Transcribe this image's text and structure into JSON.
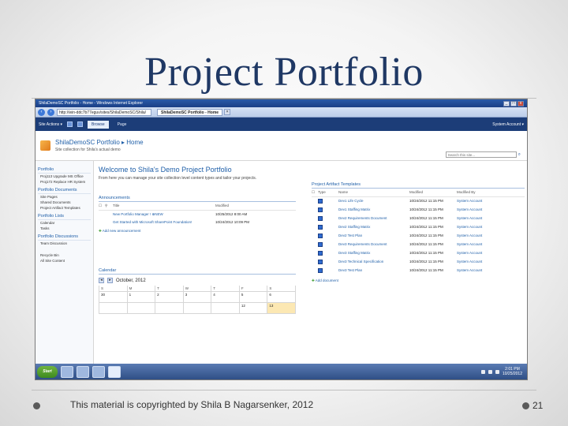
{
  "slide": {
    "title": "Project Portfolio",
    "footer": "This material is copyrighted by Shila B Nagarsenker, 2012",
    "page_number": "21"
  },
  "browser": {
    "window_title": "ShilaDemoSC Portfolio - Home - Windows Internet Explorer",
    "url": "http://win-ddc7b77eguv/sites/ShilaDemoSC/Shila/",
    "tabs": [
      {
        "label": "ShilaDemoSC Portfolio - Home"
      }
    ],
    "window_buttons": {
      "min": "_",
      "max": "□",
      "close": "x"
    }
  },
  "ribbon": {
    "site_actions": "Site Actions ▾",
    "tabs": [
      "Browse",
      "Page"
    ],
    "account": "System Account ▾"
  },
  "site": {
    "breadcrumb": "ShilaDemoSC Portfolio ▸ Home",
    "description": "Site collection for Shila's actual demo",
    "search_placeholder": "Search this site...",
    "icons": {
      "search": "search-icon",
      "logo": "site-logo-icon"
    }
  },
  "quick_launch": {
    "sections": [
      {
        "heading": "Portfolio",
        "items": [
          "Proj113 Upgrade MS Office",
          "Proj172 Replace HR System"
        ]
      },
      {
        "heading": "Portfolio Documents",
        "items": [
          "Site Pages",
          "Shared Documents",
          "Project Artifact Templates"
        ]
      },
      {
        "heading": "Portfolio Lists",
        "items": [
          "Calendar",
          "Tasks"
        ]
      },
      {
        "heading": "Portfolio Discussions",
        "items": [
          "Team Discussion"
        ]
      }
    ],
    "bottom": [
      "Recycle Bin",
      "All Site Content"
    ]
  },
  "main": {
    "welcome_title": "Welcome to Shila's Demo Project Portfolio",
    "welcome_sub": "From here you can manage your site collection level content types and tailor your projects.",
    "announcements": {
      "title": "Announcements",
      "columns": [
        "Title",
        "Modified"
      ],
      "rows": [
        {
          "title": "New Portfolio Manager ! ⊕NEW",
          "modified": "10/25/2012 8:00 AM"
        },
        {
          "title": "Get Started with Microsoft SharePoint Foundation!",
          "modified": "10/24/2012 10:09 PM"
        }
      ],
      "add_label": "Add new announcement"
    },
    "calendar": {
      "title": "Calendar",
      "month": "October, 2012",
      "days": [
        "S",
        "M",
        "T",
        "W",
        "T",
        "F",
        "S"
      ],
      "first_row": [
        "30",
        "1",
        "2",
        "3",
        "4",
        "5",
        "6"
      ],
      "last_row": [
        "",
        "",
        "",
        "",
        "",
        "12",
        "13"
      ]
    },
    "templates": {
      "title": "Project Artifact Templates",
      "columns": [
        "Type",
        "Name",
        "Modified",
        "Modified By"
      ],
      "rows": [
        {
          "name": "Dev1 Life Cycle",
          "modified": "10/24/2012 11:15 PM",
          "by": "System Account"
        },
        {
          "name": "Dev1 Staffing Matrix",
          "modified": "10/24/2012 11:15 PM",
          "by": "System Account"
        },
        {
          "name": "Dev2 Requirements Document",
          "modified": "10/24/2012 11:15 PM",
          "by": "System Account"
        },
        {
          "name": "Dev2 Staffing Matrix",
          "modified": "10/24/2012 11:15 PM",
          "by": "System Account"
        },
        {
          "name": "Dev2 Test Plan",
          "modified": "10/24/2012 11:15 PM",
          "by": "System Account"
        },
        {
          "name": "Dev3 Requirements Document",
          "modified": "10/24/2012 11:15 PM",
          "by": "System Account"
        },
        {
          "name": "Dev3 Staffing Matrix",
          "modified": "10/24/2012 11:15 PM",
          "by": "System Account"
        },
        {
          "name": "Dev3 Technical Specification",
          "modified": "10/24/2012 11:15 PM",
          "by": "System Account"
        },
        {
          "name": "Dev3 Test Plan",
          "modified": "10/24/2012 11:15 PM",
          "by": "System Account"
        }
      ],
      "add_label": "Add document"
    }
  },
  "taskbar": {
    "start_label": "Start",
    "clock_time": "2:01 PM",
    "clock_date": "10/25/2012"
  }
}
